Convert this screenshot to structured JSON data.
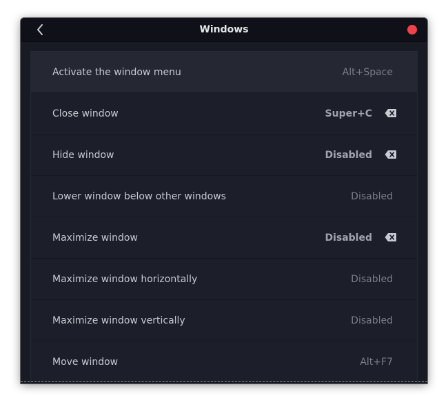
{
  "window": {
    "title": "Windows",
    "close_color": "#f0424a"
  },
  "icons": {
    "back": "chevron-left-icon",
    "close": "close-circle-icon",
    "reset": "backspace-icon"
  },
  "shortcuts": [
    {
      "label": "Activate the window menu",
      "value": "Alt+Space",
      "customized": false,
      "active": true
    },
    {
      "label": "Close window",
      "value": "Super+C",
      "customized": true,
      "active": false
    },
    {
      "label": "Hide window",
      "value": "Disabled",
      "customized": true,
      "active": false
    },
    {
      "label": "Lower window below other windows",
      "value": "Disabled",
      "customized": false,
      "active": false
    },
    {
      "label": "Maximize window",
      "value": "Disabled",
      "customized": true,
      "active": false
    },
    {
      "label": "Maximize window horizontally",
      "value": "Disabled",
      "customized": false,
      "active": false
    },
    {
      "label": "Maximize window vertically",
      "value": "Disabled",
      "customized": false,
      "active": false
    },
    {
      "label": "Move window",
      "value": "Alt+F7",
      "customized": false,
      "active": false
    }
  ]
}
